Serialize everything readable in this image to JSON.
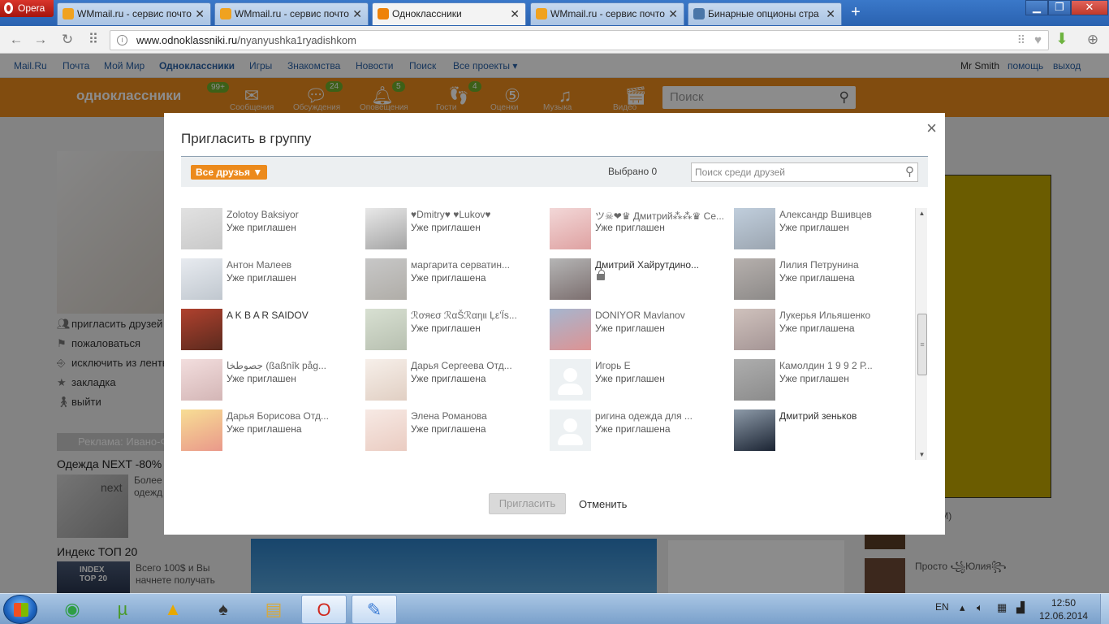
{
  "browser": {
    "menu_label": "Opera",
    "tabs": [
      {
        "title": "WMmail.ru - сервис почто",
        "active": false,
        "favicon_color": "#f0a21f"
      },
      {
        "title": "WMmail.ru - сервис почто",
        "active": false,
        "favicon_color": "#f0a21f"
      },
      {
        "title": "Одноклассники",
        "active": true,
        "favicon_color": "#ee8208"
      },
      {
        "title": "WMmail.ru - сервис почто",
        "active": false,
        "favicon_color": "#f0a21f"
      },
      {
        "title": "Бинарные опционы стра",
        "active": false,
        "favicon_color": "#4a76a8"
      }
    ],
    "new_tab": "+",
    "url_host": "www.odnoklassniki.ru",
    "url_path": "/nyanyushka1ryadishkom"
  },
  "portal": {
    "links": [
      "Mail.Ru",
      "Почта",
      "Мой Мир",
      "Одноклассники",
      "Игры",
      "Знакомства",
      "Новости",
      "Поиск",
      "Все проекты ▾"
    ],
    "user": "Mr Smith",
    "help": "помощь",
    "logout": "выход"
  },
  "ok_header": {
    "logo": "одноклассники",
    "logo_badge": "99+",
    "items": [
      {
        "label": "Сообщения",
        "icon": "envelope-icon",
        "badge": ""
      },
      {
        "label": "Обсуждения",
        "icon": "chat-icon",
        "badge": "24"
      },
      {
        "label": "Оповещения",
        "icon": "bell-icon",
        "badge": "5"
      },
      {
        "label": "Гости",
        "icon": "footprints-icon",
        "badge": "4"
      },
      {
        "label": "Оценки",
        "icon": "rating-icon",
        "badge": ""
      },
      {
        "label": "Музыка",
        "icon": "music-icon",
        "badge": ""
      },
      {
        "label": "Видео",
        "icon": "video-icon",
        "badge": ""
      }
    ],
    "search_placeholder": "Поиск"
  },
  "left_menu": {
    "items": [
      "пригласить друзей",
      "пожаловаться",
      "исключить из ленты",
      "закладка",
      "выйти"
    ]
  },
  "ads": {
    "promo_label": "Реклама: Ивано-Ф",
    "ad_title": "Одежда NEXT -80%",
    "ad_brand": "next",
    "ad_text": "Более брендо мужска одежд скидк",
    "index_title": "Индекс ТОП 20",
    "index_img_text": "INDEX TOP 20",
    "index_text": "Всего 100$ и Вы начнете получать"
  },
  "right_panel": {
    "friend1": "-ли (ГМ)",
    "friend2": "Просто ꧁Юлия꧂"
  },
  "modal": {
    "title": "Пригласить в группу",
    "close": "×",
    "filter_label": "Все друзья ▼",
    "selected": "Выбрано 0",
    "search_placeholder": "Поиск среди друзей",
    "invite_button": "Пригласить",
    "cancel_button": "Отменить",
    "friends": [
      {
        "name": "Zolotoy Baksiyor",
        "status": "Уже приглашен",
        "photo": [
          "#c9c9c9",
          "#9d9d9d"
        ],
        "default": false,
        "locked": false
      },
      {
        "name": "♥Dmitry♥ ♥Lukov♥",
        "status": "Уже приглашен",
        "photo": [
          "#d6d6d6",
          "#5a5a5a"
        ],
        "default": false,
        "locked": false
      },
      {
        "name": "ツ☠❤♛ Дмитрий⁂⁂♛ Се...",
        "status": "Уже приглашен",
        "photo": [
          "#e8b7b7",
          "#c45555"
        ],
        "default": false,
        "locked": false
      },
      {
        "name": "Александр Вшивцев",
        "status": "Уже приглашен",
        "photo": [
          "#8da6c0",
          "#4a5c70"
        ],
        "default": false,
        "locked": false
      },
      {
        "name": "Антон Малеев",
        "status": "Уже приглашен",
        "photo": [
          "#d4dae3",
          "#8d9aa8"
        ],
        "default": false,
        "locked": false
      },
      {
        "name": "маргарита серватин...",
        "status": "Уже приглашена",
        "photo": [
          "#9a9a9a",
          "#6f6a60"
        ],
        "default": false,
        "locked": false
      },
      {
        "name": "Дмитрий Хайрутдино...",
        "status": "",
        "photo": [
          "#b5b5b5",
          "#7c6f6f"
        ],
        "default": false,
        "locked": true
      },
      {
        "name": "Лилия Петрунина",
        "status": "Уже приглашена",
        "photo": [
          "#7a6f6a",
          "#2f2a27"
        ],
        "default": false,
        "locked": false
      },
      {
        "name": "A K B A R SAIDOV",
        "status": "",
        "photo": [
          "#b0412e",
          "#5a2a1e"
        ],
        "default": false,
        "locked": false
      },
      {
        "name": "ℛơяєσ ℛαŠℛαηιι Ļε'Ϊѕ...",
        "status": "Уже приглашен",
        "photo": [
          "#b8c7ad",
          "#7d8c70"
        ],
        "default": false,
        "locked": false
      },
      {
        "name": "DONIYOR Mavlanov",
        "status": "Уже приглашен",
        "photo": [
          "#5c7aa8",
          "#c23b3b"
        ],
        "default": false,
        "locked": false
      },
      {
        "name": "Лукерья Ильяшенко",
        "status": "Уже приглашена",
        "photo": [
          "#a88f86",
          "#5b3f3f"
        ],
        "default": false,
        "locked": false
      },
      {
        "name": "جصوطخا (ßaßnîk påg...",
        "status": "Уже приглашен",
        "photo": [
          "#e8c2c2",
          "#b07a7a"
        ],
        "default": false,
        "locked": false
      },
      {
        "name": "Дарья Сергеева Отд...",
        "status": "Уже приглашена",
        "photo": [
          "#f0e3d9",
          "#c8a892"
        ],
        "default": false,
        "locked": false
      },
      {
        "name": "Игорь Е",
        "status": "Уже приглашен",
        "photo": [
          "#dfe6ea",
          "#dfe6ea"
        ],
        "default": true,
        "locked": false
      },
      {
        "name": "Камолдин 1 9 9 2 Р...",
        "status": "Уже приглашен",
        "photo": [
          "#6b6b6b",
          "#2d2d2d"
        ],
        "default": false,
        "locked": false
      },
      {
        "name": "Дарья Борисова Отд...",
        "status": "Уже приглашена",
        "photo": [
          "#f1c23d",
          "#d8452b"
        ],
        "default": false,
        "locked": false
      },
      {
        "name": "Элена Романова",
        "status": "Уже приглашена",
        "photo": [
          "#f0d8cf",
          "#d9a28f"
        ],
        "default": false,
        "locked": false
      },
      {
        "name": "ригина одежда для ...",
        "status": "Уже приглашена",
        "photo": [
          "#dfe6ea",
          "#dfe6ea"
        ],
        "default": true,
        "locked": false
      },
      {
        "name": "Дмитрий зеньков",
        "status": "",
        "photo": [
          "#8d9aa8",
          "#1b2433"
        ],
        "default": false,
        "locked": false
      }
    ]
  },
  "taskbar": {
    "apps": [
      {
        "name": "chrome-icon",
        "glyph": "◉",
        "color": "#2f9e44",
        "active": false
      },
      {
        "name": "utorrent-icon",
        "glyph": "µ",
        "color": "#4a9a2a",
        "active": false
      },
      {
        "name": "avidemux-icon",
        "glyph": "▲",
        "color": "#e6a800",
        "active": false
      },
      {
        "name": "solitaire-icon",
        "glyph": "♠",
        "color": "#333333",
        "active": false
      },
      {
        "name": "explorer-icon",
        "glyph": "▤",
        "color": "#d8a93a",
        "active": false
      },
      {
        "name": "opera-icon",
        "glyph": "O",
        "color": "#d0281e",
        "active": true
      },
      {
        "name": "paint-icon",
        "glyph": "✎",
        "color": "#3a7bd5",
        "active": true
      }
    ],
    "lang": "EN",
    "time": "12:50",
    "date": "12.06.2014"
  }
}
